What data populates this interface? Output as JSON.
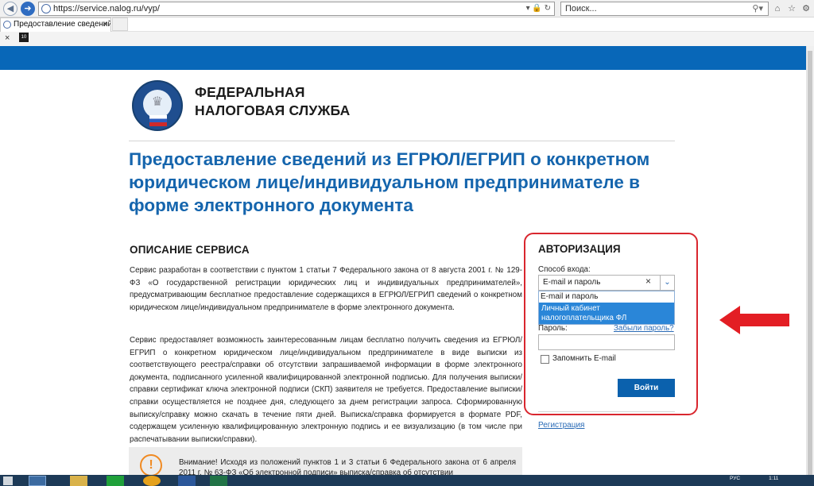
{
  "browser": {
    "url": "https://service.nalog.ru/vyp/",
    "search_placeholder": "Поиск...",
    "tab_title": "Предоставление сведений...",
    "fav_badge": "10"
  },
  "header": {
    "org_line1": "ФЕДЕРАЛЬНАЯ",
    "org_line2": "НАЛОГОВАЯ СЛУЖБА"
  },
  "page": {
    "title": "Предоставление сведений из ЕГРЮЛ/ЕГРИП о конкретном юридическом лице/индивидуальном предпринимателе в форме электронного документа"
  },
  "description": {
    "heading": "ОПИСАНИЕ СЕРВИСА",
    "p1": "Сервис разработан в соответствии с пунктом 1 статьи 7 Федерального закона от 8 августа 2001 г. № 129-ФЗ «О государственной регистрации юридических лиц и индивидуальных предпринимателей», предусматривающим бесплатное предоставление содержащихся в ЕГРЮЛ/ЕГРИП сведений о конкретном юридическом лице/индивидуальном предпринимателе в форме электронного документа.",
    "p2": "Сервис предоставляет возможность заинтересованным лицам бесплатно получить сведения из ЕГРЮЛ/ЕГРИП о конкретном юридическом лице/индивидуальном предпринимателе в виде выписки из соответствующего реестра/справки об отсутствии запрашиваемой информации в форме электронного документа, подписанного усиленной квалифицированной электронной подписью. Для получения выписки/справки сертификат ключа электронной подписи (СКП) заявителя не требуется. Предоставление выписки/справки осуществляется не позднее дня, следующего за днем регистрации запроса. Сформированную выписку/справку можно скачать в течение пяти дней. Выписка/справка формируется в формате PDF, содержащем усиленную квалифицированную электронную подпись и ее визуализацию (в том числе при распечатывании выписки/справки).",
    "warning": "Внимание! Исходя из положений пунктов 1 и 3 статьи 6 Федерального закона от 6 апреля 2011 г. № 63-ФЗ «Об электронной подписи» выписка/справка об отсутствии"
  },
  "auth": {
    "heading": "АВТОРИЗАЦИЯ",
    "login_method_label": "Способ входа:",
    "selected": "E-mail и пароль",
    "clear": "×",
    "options": [
      "E-mail и пароль",
      "Личный кабинет налогоплательщика ФЛ"
    ],
    "password_label": "Пароль:",
    "forgot": "Забыли пароль?",
    "remember": "Запомнить E-mail",
    "login_button": "Войти",
    "register": "Регистрация"
  },
  "taskbar": {
    "lang": "РУС",
    "time": "1:11"
  },
  "colors": {
    "brand_blue": "#0867b8",
    "title_blue": "#1565ad",
    "highlight_red": "#d9262e",
    "option_highlight": "#2a86d8"
  }
}
